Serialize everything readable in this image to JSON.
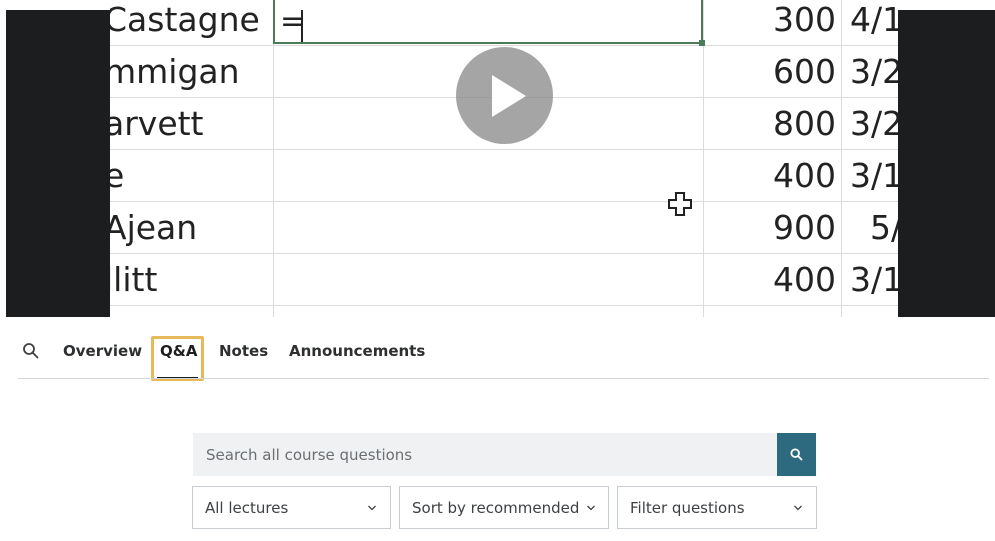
{
  "video": {
    "sheet": {
      "names": [
        "Castagne",
        "mmigan",
        "arvett",
        "e",
        "Ajean",
        "llitt"
      ],
      "amounts": [
        "300",
        "600",
        "800",
        "400",
        "900",
        "400"
      ],
      "dates": [
        "4/1",
        "3/2",
        "3/2",
        "3/1",
        "5/",
        "3/1"
      ],
      "formula": "="
    },
    "play_icon": "play-icon",
    "cursor_icon": "move-cursor-icon"
  },
  "tabs": {
    "search_icon": "search-icon",
    "items": [
      {
        "label": "Overview"
      },
      {
        "label": "Q&A"
      },
      {
        "label": "Notes"
      },
      {
        "label": "Announcements"
      }
    ],
    "active": "Q&A"
  },
  "search": {
    "placeholder": "Search all course questions",
    "button_icon": "search-icon",
    "accent": "#2d6a80"
  },
  "filters": {
    "lectures": "All lectures",
    "sort": "Sort by recommended",
    "filter": "Filter questions"
  }
}
